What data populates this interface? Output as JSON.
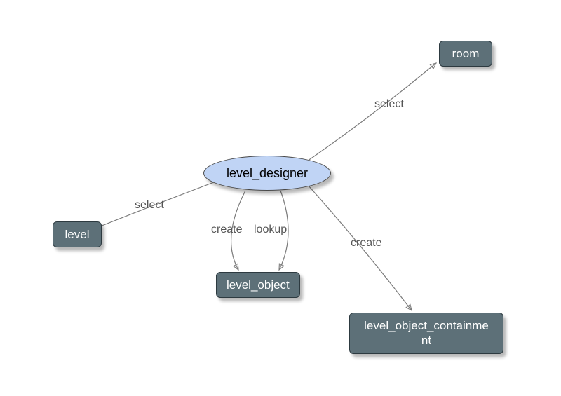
{
  "diagram": {
    "actor": {
      "label": "level_designer"
    },
    "entities": {
      "room": {
        "label": "room"
      },
      "level": {
        "label": "level"
      },
      "level_object": {
        "label": "level_object"
      },
      "containment": {
        "label": "level_object_containme\nnt"
      }
    },
    "edges": {
      "to_room": {
        "label": "select"
      },
      "to_level": {
        "label": "select"
      },
      "create_obj": {
        "label": "create"
      },
      "lookup_obj": {
        "label": "lookup"
      },
      "create_containment": {
        "label": "create"
      }
    }
  }
}
